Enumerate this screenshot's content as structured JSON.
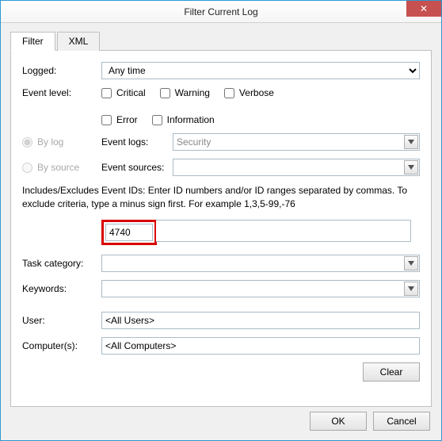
{
  "window": {
    "title": "Filter Current Log",
    "close": "✕"
  },
  "tabs": {
    "filter": "Filter",
    "xml": "XML"
  },
  "labels": {
    "logged": "Logged:",
    "eventLevel": "Event level:",
    "byLog": "By log",
    "bySource": "By source",
    "eventLogs": "Event logs:",
    "eventSources": "Event sources:",
    "taskCategory": "Task category:",
    "keywords": "Keywords:",
    "user": "User:",
    "computers": "Computer(s):"
  },
  "logged": {
    "value": "Any time"
  },
  "levels": {
    "critical": "Critical",
    "warning": "Warning",
    "verbose": "Verbose",
    "error": "Error",
    "information": "Information"
  },
  "eventLogs": {
    "value": "Security"
  },
  "eventSources": {
    "value": ""
  },
  "helpText": "Includes/Excludes Event IDs: Enter ID numbers and/or ID ranges separated by commas. To exclude criteria, type a minus sign first. For example 1,3,5-99,-76",
  "eventId": {
    "value": "4740"
  },
  "taskCategory": {
    "value": ""
  },
  "keywords": {
    "value": ""
  },
  "user": {
    "value": "<All Users>"
  },
  "computers": {
    "value": "<All Computers>"
  },
  "buttons": {
    "clear": "Clear",
    "ok": "OK",
    "cancel": "Cancel"
  }
}
